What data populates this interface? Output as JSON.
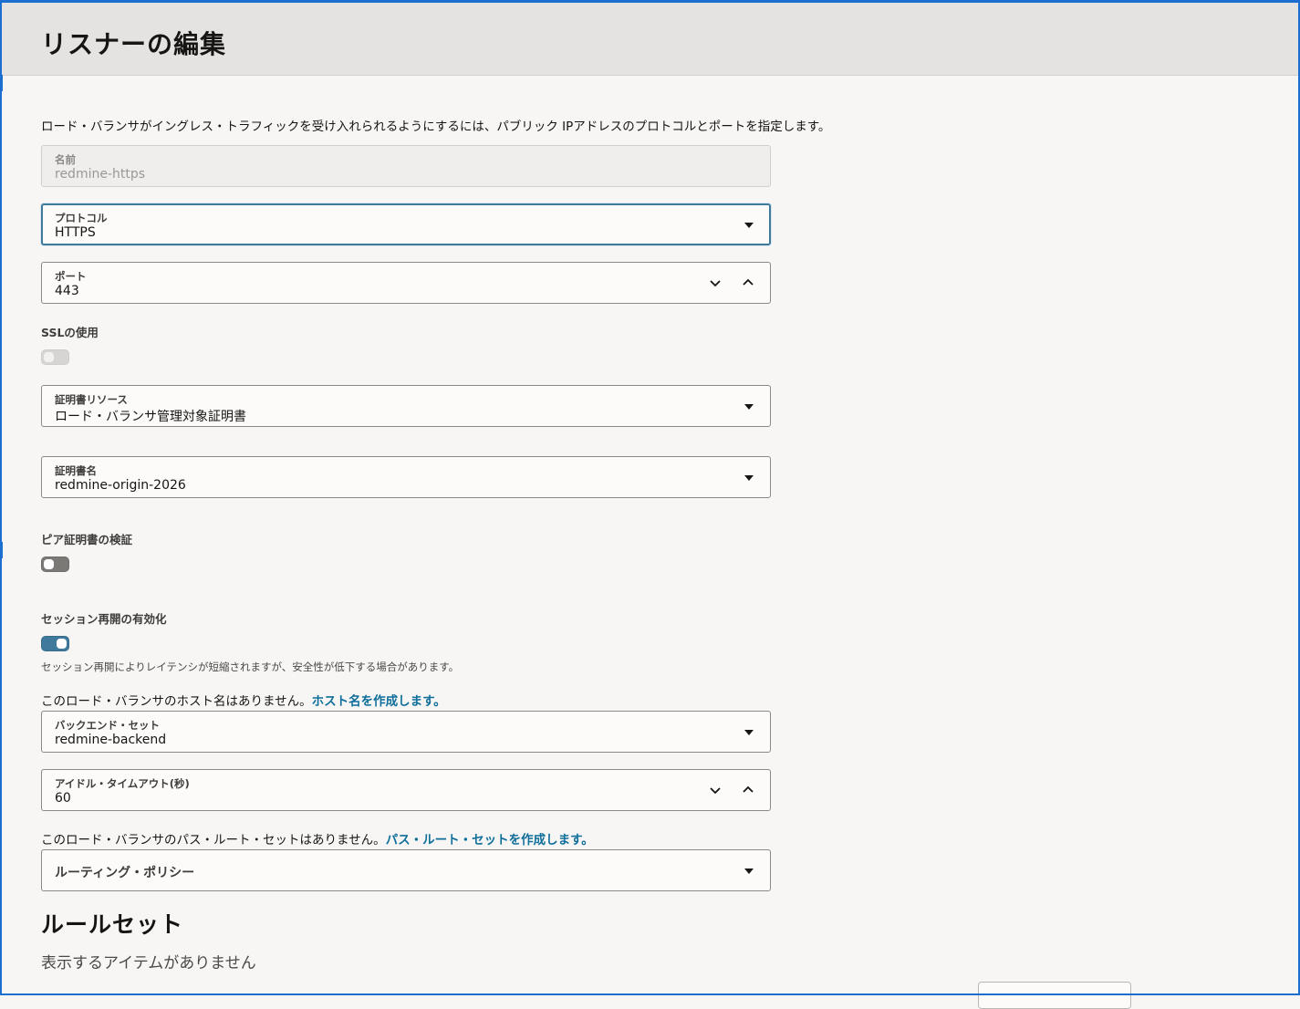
{
  "header": {
    "title": "リスナーの編集"
  },
  "description": "ロード・バランサがイングレス・トラフィックを受け入れられるようにするには、パブリック IPアドレスのプロトコルとポートを指定します。",
  "fields": {
    "name": {
      "label": "名前",
      "value": "redmine-https"
    },
    "protocol": {
      "label": "プロトコル",
      "value": "HTTPS"
    },
    "port": {
      "label": "ポート",
      "value": "443"
    },
    "cert_resource": {
      "label": "証明書リソース",
      "value": "ロード・バランサ管理対象証明書"
    },
    "cert_name": {
      "label": "証明書名",
      "value": "redmine-origin-2026"
    },
    "backend_set": {
      "label": "バックエンド・セット",
      "value": "redmine-backend"
    },
    "idle_timeout": {
      "label": "アイドル・タイムアウト(秒)",
      "value": "60"
    },
    "routing_policy": {
      "label": "ルーティング・ポリシー"
    }
  },
  "toggles": {
    "ssl": {
      "label": "SSLの使用",
      "state": "on-disabled"
    },
    "peer_verify": {
      "label": "ピア証明書の検証",
      "state": "off"
    },
    "session_resume": {
      "label": "セッション再開の有効化",
      "state": "on",
      "help": "セッション再開によりレイテンシが短縮されますが、安全性が低下する場合があります。"
    }
  },
  "hostname_info": {
    "text": "このロード・バランサのホスト名はありません。",
    "link": "ホスト名を作成します。"
  },
  "path_route_info": {
    "text": "このロード・バランサのパス・ルート・セットはありません。",
    "link": "パス・ルート・セットを作成します。"
  },
  "rule_sets": {
    "title": "ルールセット",
    "empty": "表示するアイテムがありません"
  }
}
